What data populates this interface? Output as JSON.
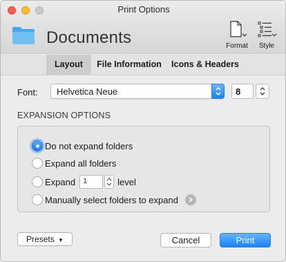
{
  "window": {
    "title": "Print Options"
  },
  "header": {
    "document_name": "Documents",
    "tools": [
      {
        "label": "Format",
        "icon": "format-icon"
      },
      {
        "label": "Style",
        "icon": "style-icon"
      }
    ]
  },
  "tabs": [
    {
      "label": "Layout",
      "selected": true
    },
    {
      "label": "File Information",
      "selected": false
    },
    {
      "label": "Icons & Headers",
      "selected": false
    }
  ],
  "font": {
    "label": "Font:",
    "family": "Helvetica Neue",
    "size": "8"
  },
  "expansion": {
    "title": "EXPANSION OPTIONS",
    "options": [
      {
        "label": "Do not expand folders",
        "selected": true
      },
      {
        "label": "Expand all folders",
        "selected": false
      },
      {
        "label": "Expand",
        "selected": false
      },
      {
        "label": "Manually select folders to expand",
        "selected": false
      }
    ],
    "level_value": "1",
    "level_label": "level"
  },
  "buttons": {
    "presets": "Presets",
    "cancel": "Cancel",
    "print": "Print"
  },
  "colors": {
    "accent": "#1a82fb",
    "close": "#fc5f57",
    "minimize": "#fdbc2f",
    "folder": "#5ab4ee"
  }
}
